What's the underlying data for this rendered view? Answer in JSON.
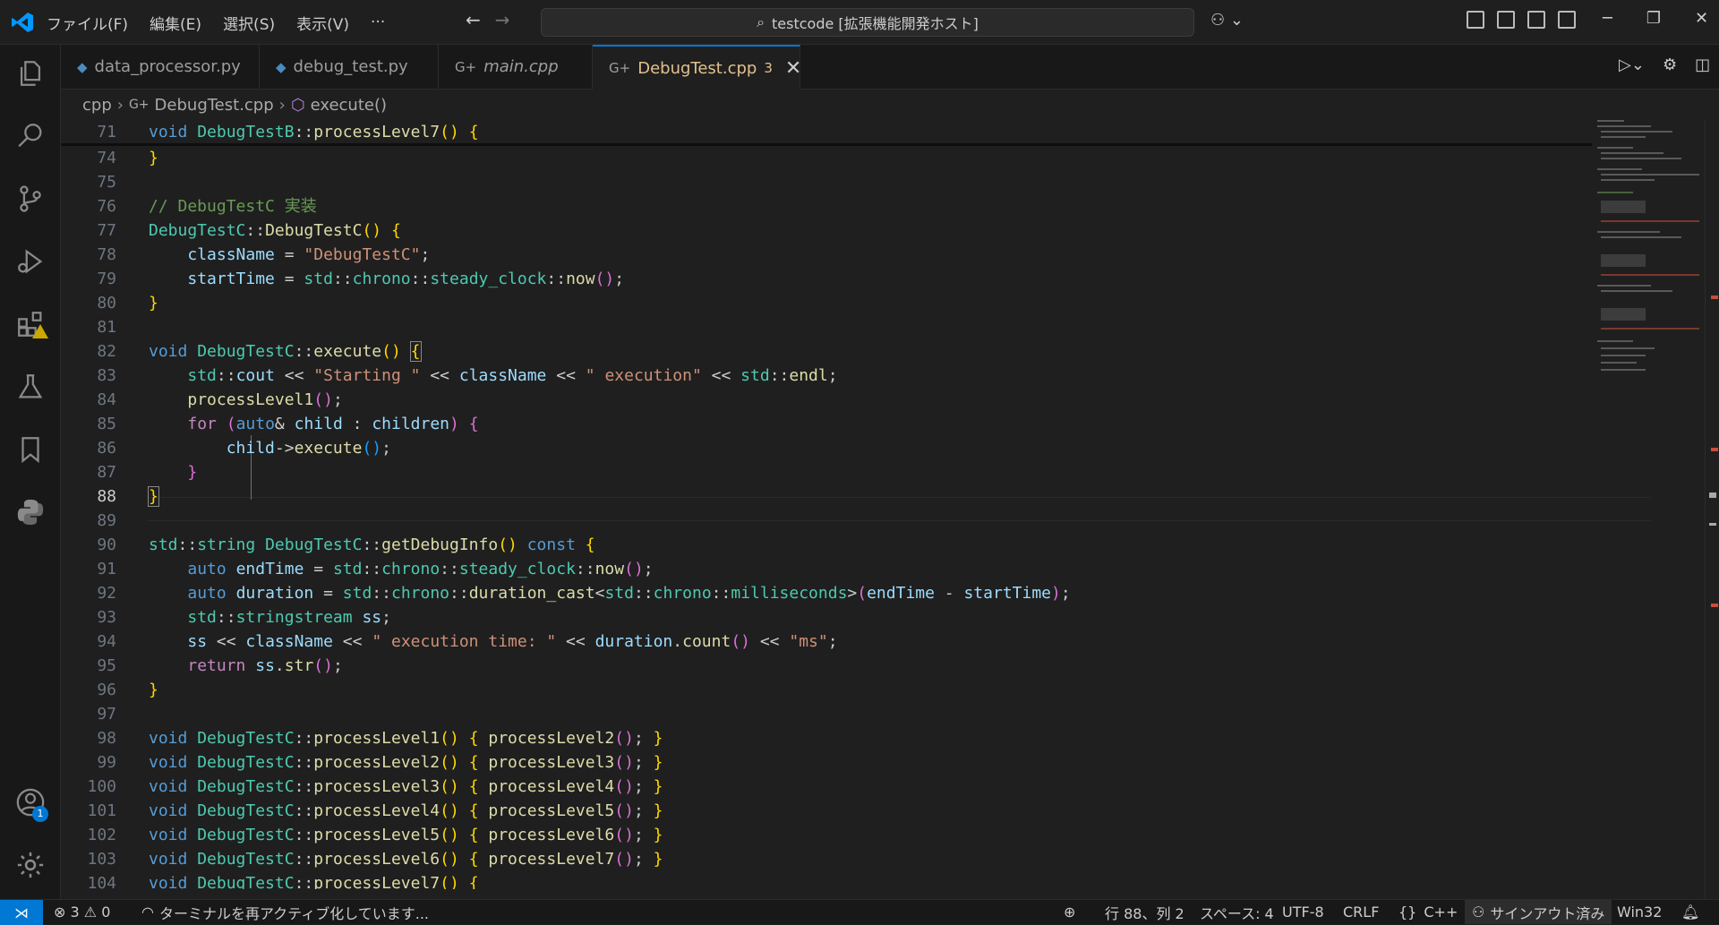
{
  "menu": [
    "ファイル(F)",
    "編集(E)",
    "選択(S)",
    "表示(V)",
    "···"
  ],
  "command_center": {
    "text": "testcode [拡張機能開発ホスト]"
  },
  "tabs": [
    {
      "label": "data_processor.py",
      "icon": "python-file-icon"
    },
    {
      "label": "debug_test.py",
      "icon": "python-file-icon"
    },
    {
      "label": "main.cpp",
      "icon": "cpp-file-icon"
    },
    {
      "label": "DebugTest.cpp",
      "problems": "3",
      "icon": "cpp-file-icon",
      "close": "✕"
    }
  ],
  "breadcrumb": {
    "folder": "cpp",
    "file": "DebugTest.cpp",
    "symbol": "execute()"
  },
  "activity_badges": {
    "accounts": "1"
  },
  "status": {
    "errors": "3",
    "warnings": "0",
    "message": "ターミナルを再アクティブ化しています...",
    "position": "行 88、列 2",
    "spaces": "スペース: 4",
    "encoding": "UTF-8",
    "eol": "CRLF",
    "language": "C++",
    "signin": "サインアウト済み",
    "platform": "Win32"
  },
  "colors": {
    "accent": "#0078d4",
    "active_tab_text": "#e2c08d",
    "error": "#c74e39"
  }
}
